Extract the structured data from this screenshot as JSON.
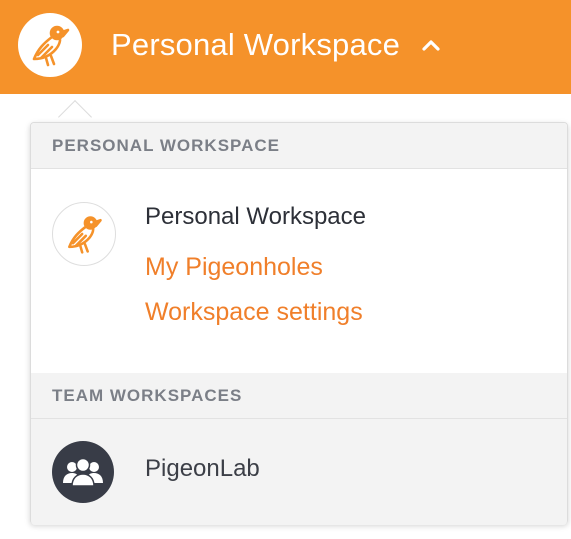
{
  "header": {
    "title": "Personal Workspace",
    "logo_icon": "bird-logo-icon",
    "chevron_icon": "chevron-up-icon",
    "background_color": "#f5922a"
  },
  "dropdown": {
    "personal_section": {
      "header": "PERSONAL WORKSPACE",
      "workspace_name": "Personal Workspace",
      "links": [
        "My Pigeonholes",
        "Workspace settings"
      ],
      "avatar_icon": "bird-logo-icon"
    },
    "team_section": {
      "header": "TEAM WORKSPACES",
      "items": [
        {
          "name": "PigeonLab",
          "icon": "group-icon"
        }
      ]
    },
    "accent_color": "#f07f2a"
  }
}
